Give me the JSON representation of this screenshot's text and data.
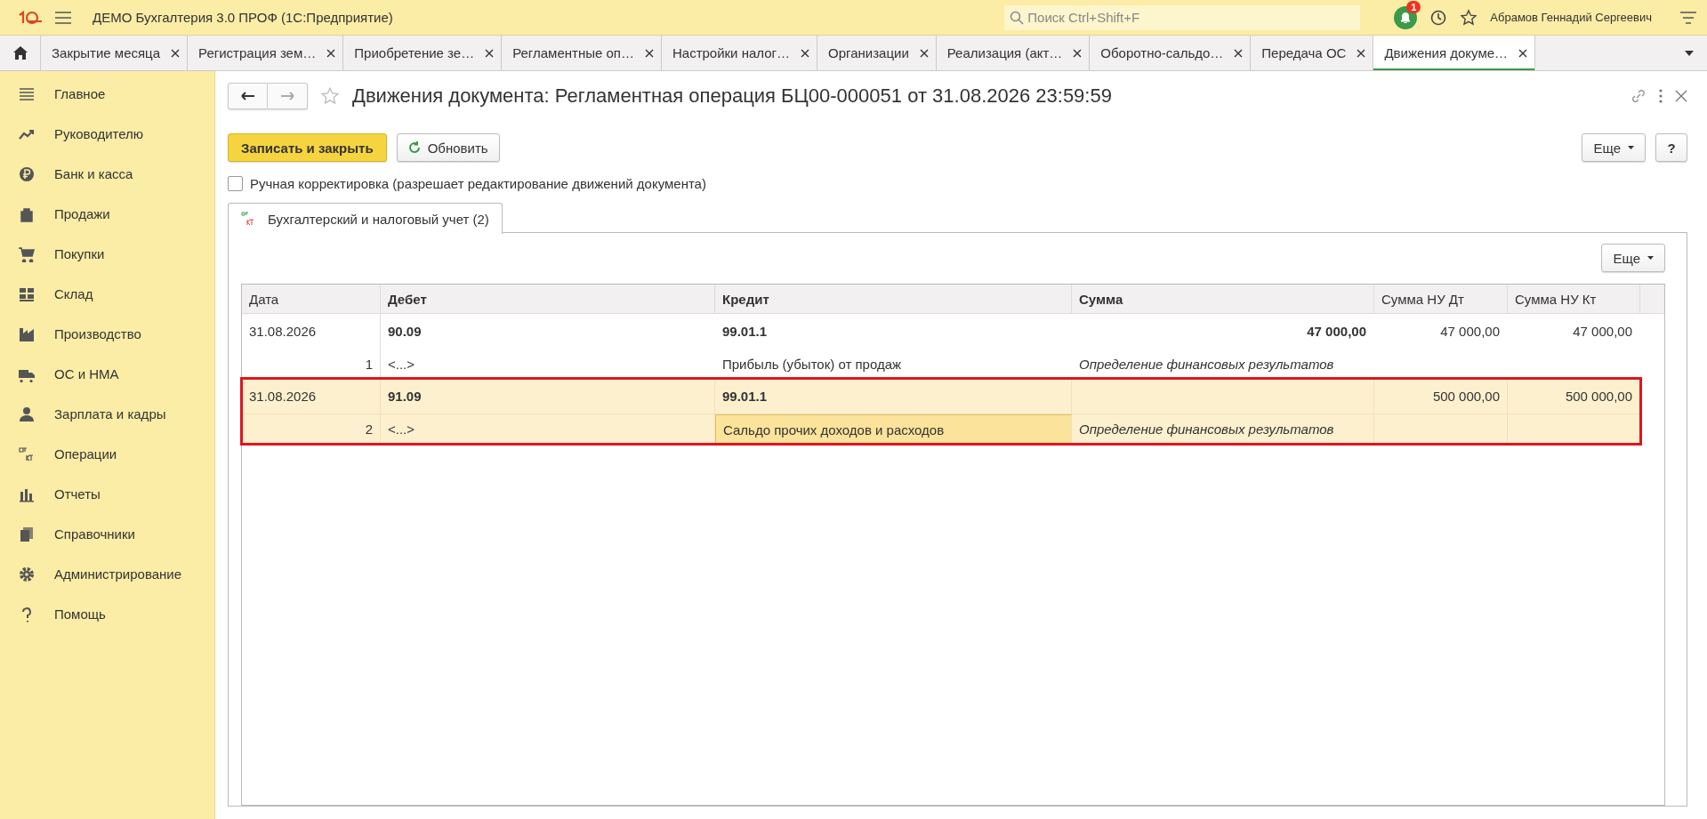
{
  "app": {
    "title": "ДЕМО Бухгалтерия 3.0 ПРОФ  (1С:Предприятие)",
    "search": {
      "placeholder": "Поиск Ctrl+Shift+F"
    },
    "notification_count": "1",
    "user": "Абрамов Геннадий Сергеевич"
  },
  "open_tabs": [
    {
      "label": "Закрытие месяца",
      "selected": false
    },
    {
      "label": "Регистрация зем…",
      "selected": false
    },
    {
      "label": "Приобретение зе…",
      "selected": false
    },
    {
      "label": "Регламентные оп…",
      "selected": false
    },
    {
      "label": "Настройки налог…",
      "selected": false
    },
    {
      "label": "Организации",
      "selected": false
    },
    {
      "label": "Реализация (акт…",
      "selected": false
    },
    {
      "label": "Оборотно-сальдо…",
      "selected": false
    },
    {
      "label": "Передача ОС",
      "selected": false
    },
    {
      "label": "Движения докуме…",
      "selected": true
    }
  ],
  "sidebar": {
    "items": [
      {
        "label": "Главное"
      },
      {
        "label": "Руководителю"
      },
      {
        "label": "Банк и касса"
      },
      {
        "label": "Продажи"
      },
      {
        "label": "Покупки"
      },
      {
        "label": "Склад"
      },
      {
        "label": "Производство"
      },
      {
        "label": "ОС и НМА"
      },
      {
        "label": "Зарплата и кадры"
      },
      {
        "label": "Операции"
      },
      {
        "label": "Отчеты"
      },
      {
        "label": "Справочники"
      },
      {
        "label": "Администрирование"
      },
      {
        "label": "Помощь"
      }
    ]
  },
  "form": {
    "title": "Движения документа: Регламентная операция БЦ00-000051 от 31.08.2026 23:59:59",
    "buttons": {
      "save_close": "Записать и закрыть",
      "refresh": "Обновить",
      "more": "Еще",
      "help": "?"
    },
    "manual_edit": {
      "label": "Ручная корректировка (разрешает редактирование движений документа)",
      "checked": false
    },
    "tabs": [
      {
        "label": "Бухгалтерский и налоговый учет (2)",
        "selected": true
      }
    ],
    "table": {
      "more": "Еще",
      "columns": [
        "Дата",
        "Дебет",
        "Кредит",
        "Сумма",
        "Сумма НУ Дт",
        "Сумма НУ Кт"
      ],
      "rows": [
        {
          "date": "31.08.2026",
          "number": "1",
          "debit": "90.09",
          "debit_sub": "<...>",
          "credit": "99.01.1",
          "credit_sub": "Прибыль (убыток) от продаж",
          "sum": "47 000,00",
          "content": "Определение финансовых результатов",
          "sum_nu_dt": "47 000,00",
          "sum_nu_kt": "47 000,00",
          "selected": false,
          "highlighted": false
        },
        {
          "date": "31.08.2026",
          "number": "2",
          "debit": "91.09",
          "debit_sub": "<...>",
          "credit": "99.01.1",
          "credit_sub": "Сальдо прочих доходов и расходов",
          "content": "Определение финансовых результатов",
          "sum_nu_dt": "500 000,00",
          "sum_nu_kt": "500 000,00",
          "selected": true,
          "highlighted": true
        }
      ]
    }
  }
}
